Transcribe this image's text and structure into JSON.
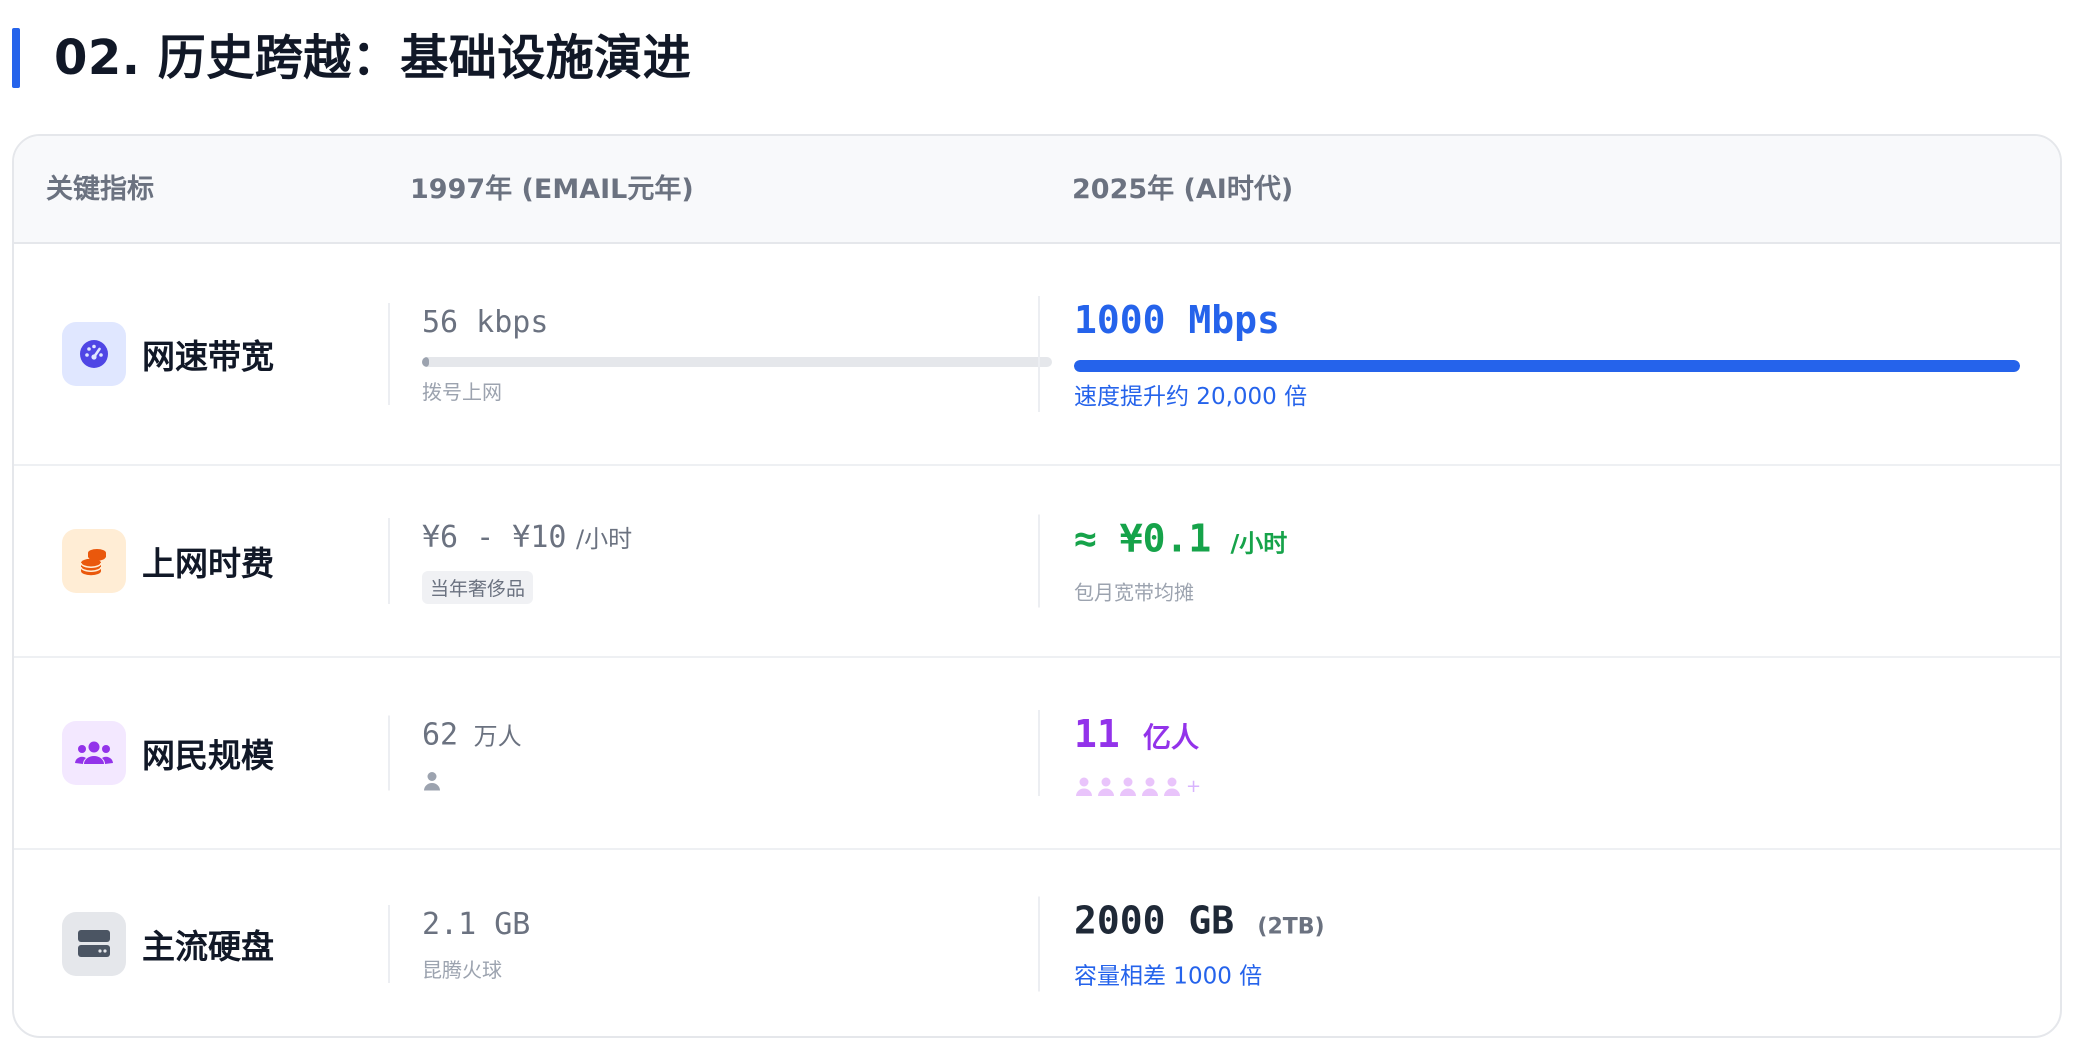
{
  "page": {
    "title": "02. 历史跨越：基础设施演进"
  },
  "table": {
    "headers": {
      "metric": "关键指标",
      "y1997": "1997年 (EMAIL元年)",
      "y2025": "2025年 (AI时代)"
    },
    "rows": [
      {
        "metric": "网速带宽",
        "icon": "speedometer-icon",
        "old": {
          "value": "56 kbps",
          "note": "拨号上网",
          "bar_fraction": 0.003
        },
        "new": {
          "value": "1000 Mbps",
          "note": "速度提升约 20,000 倍",
          "bar_fraction": 1.0
        }
      },
      {
        "metric": "上网时费",
        "icon": "coins-icon",
        "old": {
          "value": "¥6 - ¥10",
          "unit": "/小时",
          "tag": "当年奢侈品"
        },
        "new": {
          "value": "≈ ¥0.1",
          "unit": "/小时",
          "note": "包月宽带均摊"
        }
      },
      {
        "metric": "网民规模",
        "icon": "users-icon",
        "old": {
          "value": "62",
          "unit": "万人",
          "people_icons": 1
        },
        "new": {
          "value": "11",
          "unit": "亿人",
          "people_icons": 5,
          "plus": "+"
        }
      },
      {
        "metric": "主流硬盘",
        "icon": "hard-drive-icon",
        "old": {
          "value": "2.1 GB",
          "note": "昆腾火球"
        },
        "new": {
          "value": "2000 GB",
          "unit": "(2TB)",
          "note": "容量相差 1000 倍"
        }
      }
    ]
  },
  "colors": {
    "accent_blue": "#2563eb",
    "accent_green": "#16a34a",
    "accent_purple": "#9333ea",
    "accent_orange": "#ea580c",
    "indigo": "#4f46e5"
  }
}
